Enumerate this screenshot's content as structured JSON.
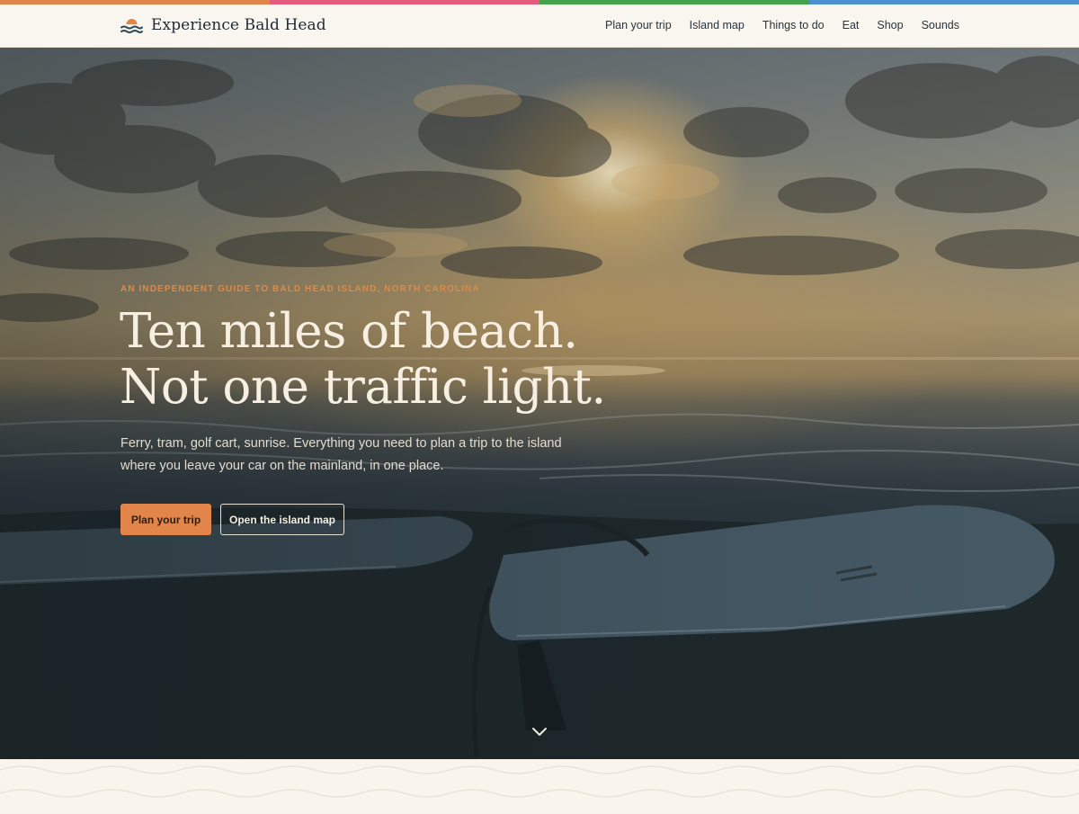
{
  "brand": {
    "name": "Experience Bald Head",
    "logo_icon": "sun-over-waves-icon",
    "stripe_colors": [
      "#e2854a",
      "#e45b7e",
      "#43a34a",
      "#4a8fcf"
    ]
  },
  "nav": {
    "items": [
      {
        "label": "Plan your trip"
      },
      {
        "label": "Island map"
      },
      {
        "label": "Things to do"
      },
      {
        "label": "Eat"
      },
      {
        "label": "Shop"
      },
      {
        "label": "Sounds"
      }
    ]
  },
  "hero": {
    "eyebrow": "AN INDEPENDENT GUIDE TO BALD HEAD ISLAND, NORTH CAROLINA",
    "headline_line1": "Ten miles of beach.",
    "headline_line2": "Not one traffic light.",
    "lede": "Ferry, tram, golf cart, sunrise. Everything you need to plan a trip to the island where you leave your car on the mainland, in one place.",
    "primary_cta": "Plan your trip",
    "secondary_cta": "Open the island map",
    "scroll_icon": "chevron-down-icon",
    "accent_color": "#e2854a"
  }
}
